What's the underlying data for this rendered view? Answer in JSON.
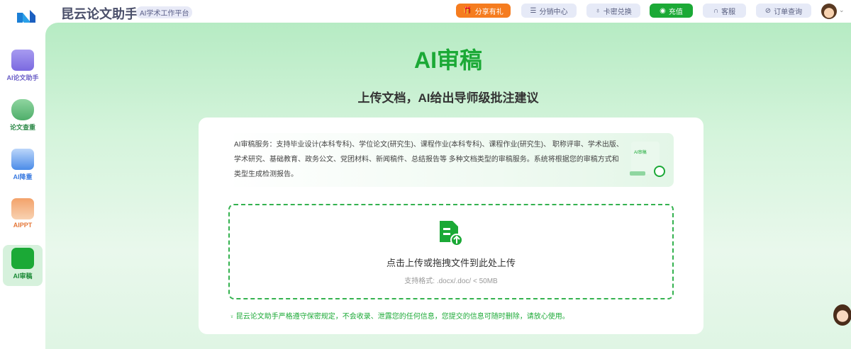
{
  "header": {
    "app_title": "昆云论文助手",
    "subtitle_badge": "AI学术工作平台",
    "buttons": [
      {
        "label": "分享有礼",
        "icon": "gift-icon"
      },
      {
        "label": "分销中心",
        "icon": "database-icon"
      },
      {
        "label": "卡密兑换",
        "icon": "key-icon"
      },
      {
        "label": "充值",
        "icon": "coin-icon"
      },
      {
        "label": "客服",
        "icon": "headset-icon"
      },
      {
        "label": "订单查询",
        "icon": "search-order-icon"
      }
    ]
  },
  "sidebar": {
    "items": [
      {
        "label": "AI论文助手",
        "color": "#6b5fc7"
      },
      {
        "label": "论文查重",
        "color": "#2f8a4a"
      },
      {
        "label": "AI降重",
        "color": "#3b7be0"
      },
      {
        "label": "AIPPT",
        "color": "#e5783a"
      },
      {
        "label": "AI审稿",
        "color": "#1ba936",
        "active": true
      }
    ]
  },
  "main": {
    "title": "AI审稿",
    "subtitle": "上传文档，AI给出导师级批注建议",
    "description": "AI审稿服务：支持毕业设计(本科专科)、学位论文(研究生)、课程作业(本科专科)、课程作业(研究生)、 职称评审、学术出版、学术研究、基础教育、政务公文、党团材料、新闻稿件、总结报告等 多种文档类型的审稿服务。系统将根据您的审稿方式和类型生成检测报告。",
    "illustration_label": "AI审稿",
    "upload_text": "点击上传或拖拽文件到此处上传",
    "upload_formats": "支持格式: .docx/.doc/ < 50MB",
    "privacy_note": "昆云论文助手严格遵守保密规定，不会收录、泄露您的任何信息，您提交的信息可随时删除，请放心使用。"
  },
  "accent": "#1ba936"
}
